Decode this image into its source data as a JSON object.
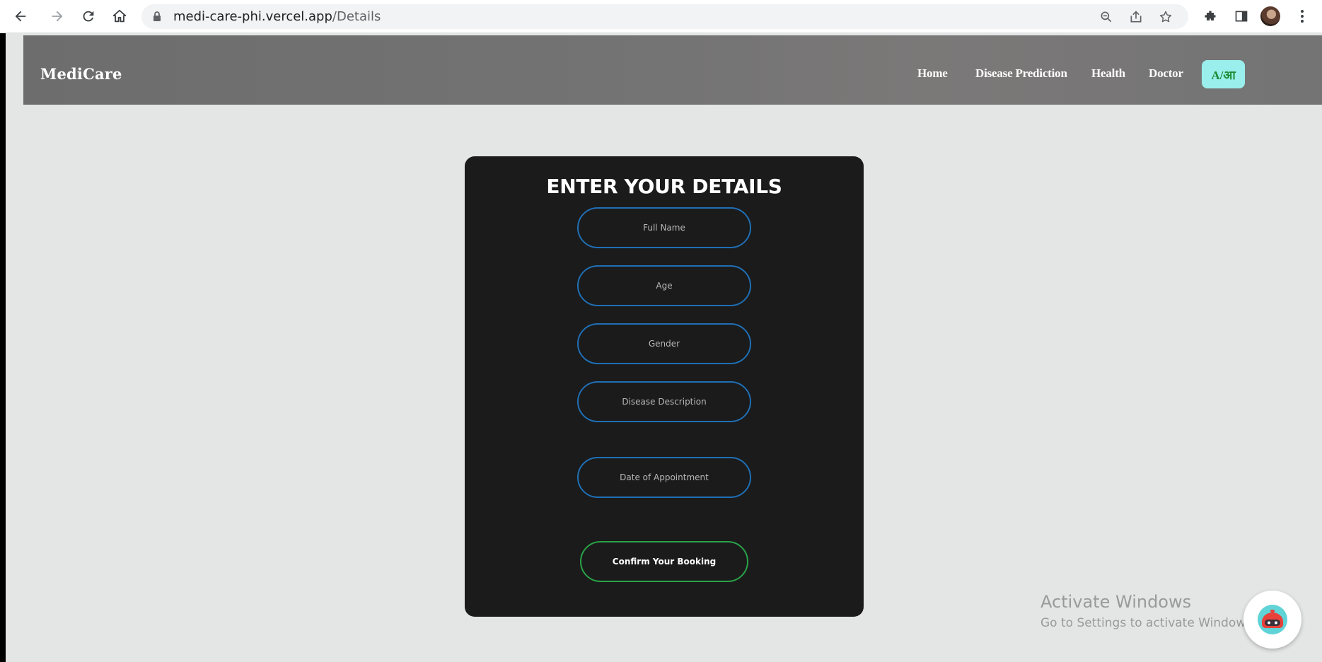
{
  "browser": {
    "url_host": "medi-care-phi.vercel.app",
    "url_path": "/Details"
  },
  "navbar": {
    "brand": "MediCare",
    "links": [
      "Home",
      "Disease Prediction",
      "Health",
      "Doctor"
    ],
    "lang_toggle": "A/आ",
    "lang_toggle_color": "#9aefec"
  },
  "form": {
    "title": "ENTER YOUR DETAILS",
    "fields": {
      "full_name": "Full Name",
      "age": "Age",
      "gender": "Gender",
      "disease_description": "Disease Description",
      "date_of_appointment": "Date of Appointment"
    },
    "submit_label": "Confirm Your Booking",
    "field_border_color": "#1f6fb5",
    "submit_border_color": "#29a348"
  },
  "watermark": {
    "title": "Activate Windows",
    "subtitle": "Go to Settings to activate Windows."
  },
  "icons": {
    "chat_fab": "chatbot-icon"
  }
}
